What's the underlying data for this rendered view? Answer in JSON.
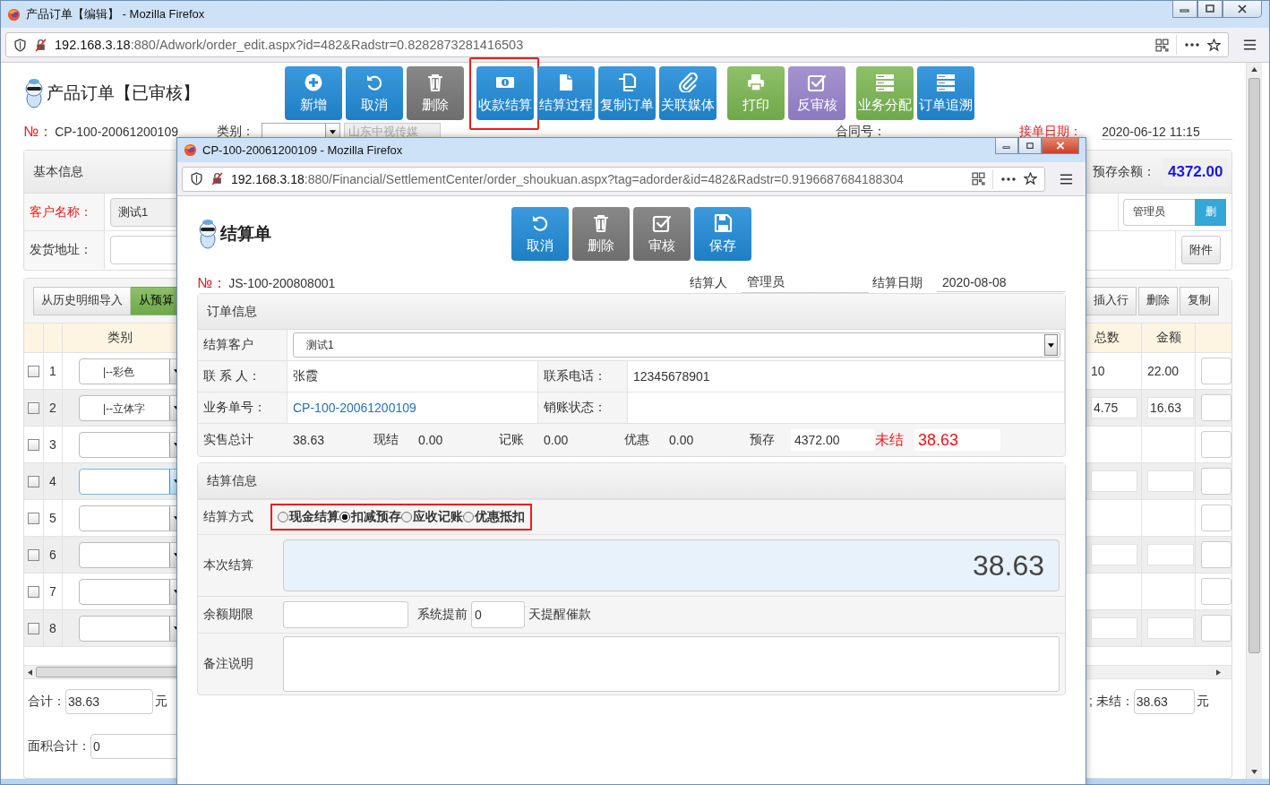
{
  "main_window": {
    "title": "产品订单【编辑】 - Mozilla Firefox",
    "url_host": "192.168.3.18",
    "url_rest": ":880/Adwork/order_edit.aspx?id=482&Radstr=0.8282873281416503",
    "page_title": "产品订单【已审核】",
    "toolbar_groups": [
      [
        {
          "label": "新增",
          "kind": "primary",
          "highlighted": false
        },
        {
          "label": "取消",
          "kind": "primary",
          "highlighted": false
        },
        {
          "label": "删除",
          "kind": "disabled",
          "highlighted": false
        }
      ],
      [
        {
          "label": "收款结算",
          "kind": "primary",
          "highlighted": true
        },
        {
          "label": "结算过程",
          "kind": "primary",
          "highlighted": false
        },
        {
          "label": "复制订单",
          "kind": "primary",
          "highlighted": false
        },
        {
          "label": "关联媒体",
          "kind": "primary",
          "highlighted": false
        }
      ],
      [
        {
          "label": "打印",
          "kind": "success",
          "highlighted": false
        },
        {
          "label": "反审核",
          "kind": "purple",
          "highlighted": false
        }
      ],
      [
        {
          "label": "业务分配",
          "kind": "success",
          "highlighted": false
        },
        {
          "label": "订单追溯",
          "kind": "primary",
          "highlighted": false
        }
      ]
    ],
    "order_no_label": "№：",
    "order_no": "CP-100-20061200109",
    "category_label": "类别：",
    "media_value": "山东中视传媒",
    "contract_label": "合同号：",
    "date_label": "接单日期：",
    "date_value": "2020-06-12 11:15",
    "basic_info": {
      "heading": "基本信息",
      "customer_label": "客户名称：",
      "customer_value": "测试1",
      "address_label": "发货地址：",
      "prepaid_label": "预存余额：",
      "prepaid_value": "4372.00",
      "owner_value": "管理员",
      "owner_remove": "删",
      "attachment_button": "附件"
    },
    "detail": {
      "buttons_left": [
        {
          "label": "从历史明细导入",
          "kind": "default"
        },
        {
          "label": "从预算",
          "kind": "success"
        }
      ],
      "buttons_right": [
        "插入行",
        "删除",
        "复制"
      ],
      "columns": [
        "类别",
        "总数",
        "金额"
      ],
      "rows": [
        {
          "no": "1",
          "checked": false,
          "category": "|--彩色",
          "total": "10",
          "amount": "22.00",
          "editable": false,
          "focused": false
        },
        {
          "no": "2",
          "checked": false,
          "category": "|--立体字",
          "total": "4.75",
          "amount": "16.63",
          "editable": true,
          "focused": false
        },
        {
          "no": "3",
          "checked": false,
          "editable": false,
          "focused": false
        },
        {
          "no": "4",
          "checked": false,
          "editable": true,
          "focused": true
        },
        {
          "no": "5",
          "checked": false,
          "editable": false,
          "focused": false
        },
        {
          "no": "6",
          "checked": false,
          "editable": true,
          "focused": false
        },
        {
          "no": "7",
          "checked": false,
          "editable": false,
          "focused": false
        },
        {
          "no": "8",
          "checked": false,
          "editable": true,
          "focused": false
        }
      ]
    },
    "footer": {
      "sum_label": "合计：",
      "sum_value": "38.63",
      "sum_unit": "元",
      "area_label": "面积合计：",
      "area_value": "0",
      "unsettled_label": "; 未结：",
      "unsettled_value": "38.63",
      "unsettled_unit": "元"
    }
  },
  "popup": {
    "title": "CP-100-20061200109 - Mozilla Firefox",
    "url_host": "192.168.3.18",
    "url_rest": ":880/Financial/SettlementCenter/order_shoukuan.aspx?tag=adorder&id=482&Radstr=0.9196687684188304",
    "page_title": "结算单",
    "toolbar": [
      {
        "label": "取消",
        "kind": "primary"
      },
      {
        "label": "删除",
        "kind": "disabled"
      },
      {
        "label": "审核",
        "kind": "disabled"
      },
      {
        "label": "保存",
        "kind": "primary"
      }
    ],
    "no_label": "№：",
    "no_value": "JS-100-200808001",
    "settler_label": "结算人",
    "settler_value": "管理员",
    "date_label": "结算日期",
    "date_value": "2020-08-08",
    "order_info": {
      "heading": "订单信息",
      "customer_label": "结算客户",
      "customer_value": "测试1",
      "contact_label": "联 系 人：",
      "contact_value": "张霞",
      "phone_label": "联系电话：",
      "phone_value": "12345678901",
      "business_no_label": "业务单号：",
      "business_no_value": "CP-100-20061200109",
      "writeoff_label": "销账状态：",
      "summary": [
        {
          "label": "实售总计",
          "value": "38.63",
          "kind": "text"
        },
        {
          "label": "现结",
          "value": "0.00",
          "kind": "text"
        },
        {
          "label": "记账",
          "value": "0.00",
          "kind": "text"
        },
        {
          "label": "优惠",
          "value": "0.00",
          "kind": "text"
        },
        {
          "label": "预存",
          "value": "4372.00",
          "kind": "field"
        },
        {
          "label": "未结",
          "value": "38.63",
          "kind": "alert"
        }
      ]
    },
    "settlement": {
      "heading": "结算信息",
      "method_label": "结算方式",
      "methods_highlighted": true,
      "methods": [
        {
          "label": "现金结算",
          "selected": false
        },
        {
          "label": "扣减预存",
          "selected": true
        },
        {
          "label": "应收记账",
          "selected": false
        },
        {
          "label": "优惠抵扣",
          "selected": false
        }
      ],
      "amount_label": "本次结算",
      "amount_value": "38.63",
      "deadline_label": "余额期限",
      "remind_before_label": "系统提前",
      "remind_days": "0",
      "remind_after_label": "天提醒催款",
      "note_label": "备注说明"
    }
  }
}
